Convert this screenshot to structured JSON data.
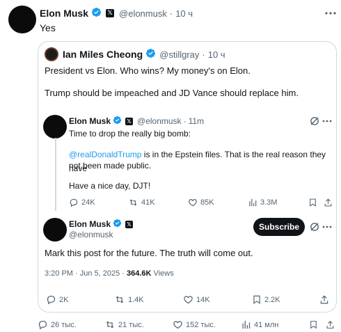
{
  "main_post": {
    "author_name": "Elon Musk",
    "handle": "@elonmusk",
    "time": "10 ч",
    "text": "Yes",
    "stats": {
      "replies": "26 тыс.",
      "reposts": "21 тыс.",
      "likes": "152 тыс.",
      "views": "41 млн"
    }
  },
  "quoted_post": {
    "author_name": "Ian Miles Cheong",
    "handle": "@stillgray",
    "time": "10 ч",
    "text_line1": "President vs Elon. Who wins? My money's on Elon.",
    "text_line2": "Trump should be impeached and JD Vance should replace him."
  },
  "inner_post": {
    "author_name": "Elon Musk",
    "handle": "@elonmusk",
    "time": "11m",
    "text_line1": "Time to drop the really big bomb:",
    "mention": "@realDonaldTrump",
    "text_line2_rest": " is in the Epstein files. That is the real reason they have",
    "text_line3": "not been made public.",
    "text_line4": "Have a nice day, DJT!",
    "stats": {
      "replies": "24K",
      "reposts": "41K",
      "likes": "85K",
      "views": "3.3M"
    }
  },
  "reply_post": {
    "author_name": "Elon Musk",
    "handle": "@elonmusk",
    "subscribe_label": "Subscribe",
    "text": "Mark this post for the future. The truth will come out.",
    "date": "3:20 PM · Jun 5, 2025 · ",
    "views_count": "364.6K",
    "views_label": " Views",
    "stats": {
      "replies": "2K",
      "reposts": "1.4K",
      "likes": "14K",
      "bookmarks": "2.2K"
    }
  },
  "colors": {
    "link": "#1d9bf0",
    "verified": "#1d9bf0",
    "muted": "#536471",
    "border": "#cfd9de"
  },
  "icons": [
    "verified-icon",
    "x-logo-icon",
    "more-icon",
    "reply-icon",
    "repost-icon",
    "like-icon",
    "views-icon",
    "bookmark-icon",
    "share-icon",
    "grok-icon"
  ]
}
